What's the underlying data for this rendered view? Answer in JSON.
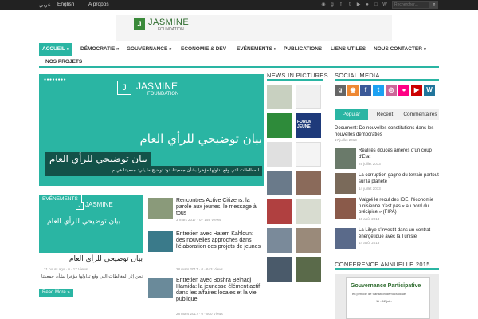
{
  "topbar": {
    "lang_ar": "عربي",
    "lang_en": "English",
    "apropos": "A propos",
    "search_placeholder": "Rechercher...",
    "social_icons": [
      "rss-icon",
      "google-plus-icon",
      "facebook-icon",
      "twitter-icon",
      "youtube-icon",
      "flickr-icon",
      "instagram-icon",
      "wordpress-icon"
    ]
  },
  "logo": {
    "name": "JASMINE",
    "sub": "FOUNDATION"
  },
  "nav": {
    "items": [
      {
        "label": "ACCUEIL »",
        "active": true
      },
      {
        "label": "DÉMOCRATIE »"
      },
      {
        "label": "GOUVERNANCE »"
      },
      {
        "label": "ECONOMIE & DEV"
      },
      {
        "label": "EVÉNEMENTS »"
      },
      {
        "label": "PUBLICATIONS"
      },
      {
        "label": "LIENS UTILES"
      },
      {
        "label": "NOUS CONTACTER »"
      },
      {
        "label": "NOS PROJETS"
      }
    ]
  },
  "slider": {
    "logo_name": "JASMINE",
    "logo_sub": "FOUNDATION",
    "big_text": "بيان توضيحي للرأي العام",
    "caption_title": "بيان توضيحي للرأي العام",
    "caption_desc": "المغالطات التي وقع تداولها مؤخرا بشأن جمعيتنا، نود توضيح ما يلي: جمعيتنا هي م..."
  },
  "events": {
    "label": "EVÉNEMENTS",
    "thumb_logo_name": "JASMINE",
    "thumb_logo_sub": "FOUNDATION",
    "thumb_text": "بيان توضيحي للرأي العام",
    "title": "بيان توضيحي للرأي العام",
    "meta": "21 hours ago  ·  0  ·  17 Views",
    "desc": "نحن  إثر المغالطات التي وقع تداولها مؤخرا بشأن جمعيتنا",
    "readmore": "Read More »"
  },
  "posts": [
    {
      "title": "Rencontres Active Citizens: la parole aux jeunes, le message à tous",
      "meta": "3 mars 2017  ·  0  ·  159 Views"
    },
    {
      "title": "Entretien avec Hatem Kahloun: des nouvelles approches dans l'élaboration des projets de jeunes",
      "meta": "28 mars 2017  ·  0  ·  643 Views"
    },
    {
      "title": "Entretien avec Boshra Belhadj Hamida: la jeunesse élément actif dans les affaires locales et la vie publique",
      "meta": "28 mars 2017  ·  0  ·  500 Views"
    }
  ],
  "news_in_pictures": {
    "title": "NEWS IN PICTURES",
    "forum_label": "FORUM JEUNE"
  },
  "social": {
    "title": "SOCIAL MEDIA"
  },
  "tabs": {
    "popular": "Popular",
    "recent": "Recent",
    "comments": "Commentaires"
  },
  "side_posts": [
    {
      "title": "Document: De nouvelles constitutions dans les nouvelles démocraties",
      "date": "17 juillet 2013"
    },
    {
      "title": "Réalités douces amères d'un coup d'Etat",
      "date": "29 juillet 2013"
    },
    {
      "title": "La corruption gagne du terrain partout sur la planète",
      "date": "14 juillet 2013"
    },
    {
      "title": "Malgré le recul des IDE, l'économie tunisienne n'est pas « au bord du précipice » (FIPA)",
      "date": "16 août 2013"
    },
    {
      "title": "La Libye s'investit dans un contrat énergétique avec la Tunisie",
      "date": "14 août 2013"
    }
  ],
  "conference": {
    "title": "CONFÉRENCE ANNUELLE 2015",
    "poster_title": "Gouvernance Participative",
    "poster_sub": "en période de transition démocratique",
    "poster_date": "11 - 12 juin"
  },
  "colors": {
    "accent": "#2ab5a3",
    "dark": "#222222"
  }
}
